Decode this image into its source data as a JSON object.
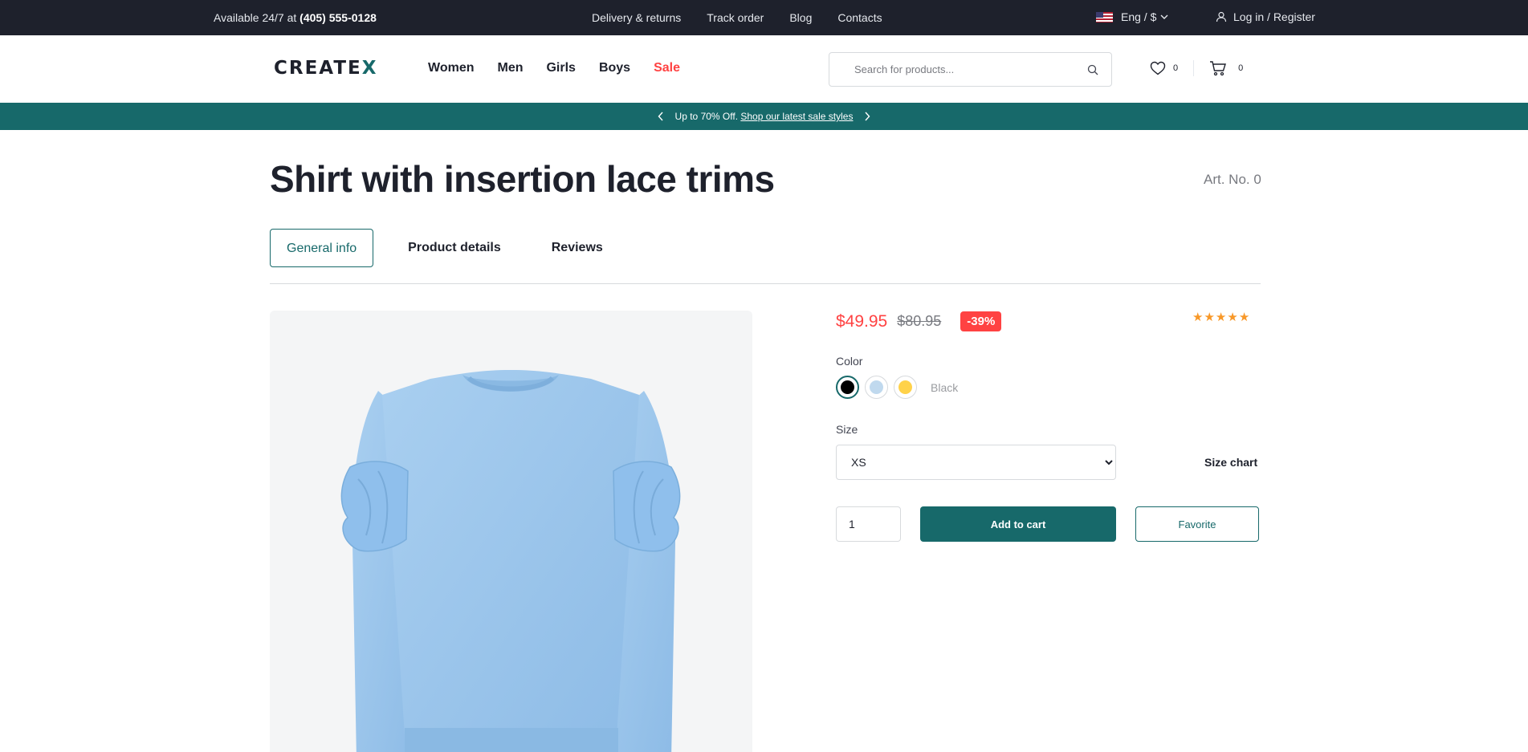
{
  "topbar": {
    "availability_prefix": "Available 24/7 at ",
    "phone": "(405) 555-0128",
    "links": [
      "Delivery & returns",
      "Track order",
      "Blog",
      "Contacts"
    ],
    "language": "Eng / $",
    "login": "Log in / Register"
  },
  "header": {
    "logo_main": "CREATE",
    "logo_x": "X",
    "nav": [
      "Women",
      "Men",
      "Girls",
      "Boys",
      "Sale"
    ],
    "search_placeholder": "Search for products...",
    "wishlist_count": "0",
    "cart_count": "0"
  },
  "promo": {
    "text": "Up to 70% Off. ",
    "link": "Shop our latest sale styles"
  },
  "product": {
    "title": "Shirt with insertion lace trims",
    "art_no": "Art. No. 0",
    "tabs": [
      "General info",
      "Product details",
      "Reviews"
    ],
    "price": "$49.95",
    "old_price": "$80.95",
    "discount": "-39%",
    "rating": 5,
    "color_label": "Color",
    "colors": [
      "#000000",
      "#c0d9ee",
      "#ffd24a"
    ],
    "selected_color": "Black",
    "size_label": "Size",
    "size_selected": "XS",
    "size_chart": "Size chart",
    "quantity": "1",
    "add_to_cart": "Add to cart",
    "favorite": "Favorite"
  },
  "colors": {
    "dark": "#1e212c",
    "primary": "#17696a",
    "sale": "#ff4242",
    "star": "#f89828",
    "image_bg": "#f4f5f6",
    "garment": "#9ec7ec"
  }
}
